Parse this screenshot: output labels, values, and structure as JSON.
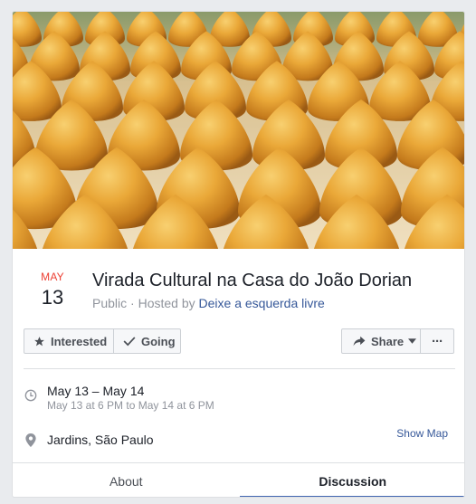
{
  "event": {
    "month": "MAY",
    "day": "13",
    "title": "Virada Cultural na Casa do João Dorian",
    "privacy": "Public",
    "hosted_by_prefix": " · Hosted by ",
    "host": "Deixe a esquerda livre"
  },
  "actions": {
    "interested": "Interested",
    "going": "Going",
    "share": "Share",
    "more": "···"
  },
  "details": {
    "date_range": "May 13 – May 14",
    "date_detail": "May 13 at 6 PM to May 14 at 6 PM",
    "location": "Jardins, São Paulo",
    "show_map": "Show Map"
  },
  "tabs": [
    {
      "label": "About",
      "active": false
    },
    {
      "label": "Discussion",
      "active": true
    }
  ],
  "colors": {
    "accent": "#4267b2",
    "link": "#365899",
    "month_red": "#ec3f32",
    "food_gold": "#e0a030"
  },
  "icons": {
    "interested": "star-icon",
    "going": "check-icon",
    "share": "share-arrow-icon",
    "time": "clock-icon",
    "location": "map-pin-icon"
  }
}
